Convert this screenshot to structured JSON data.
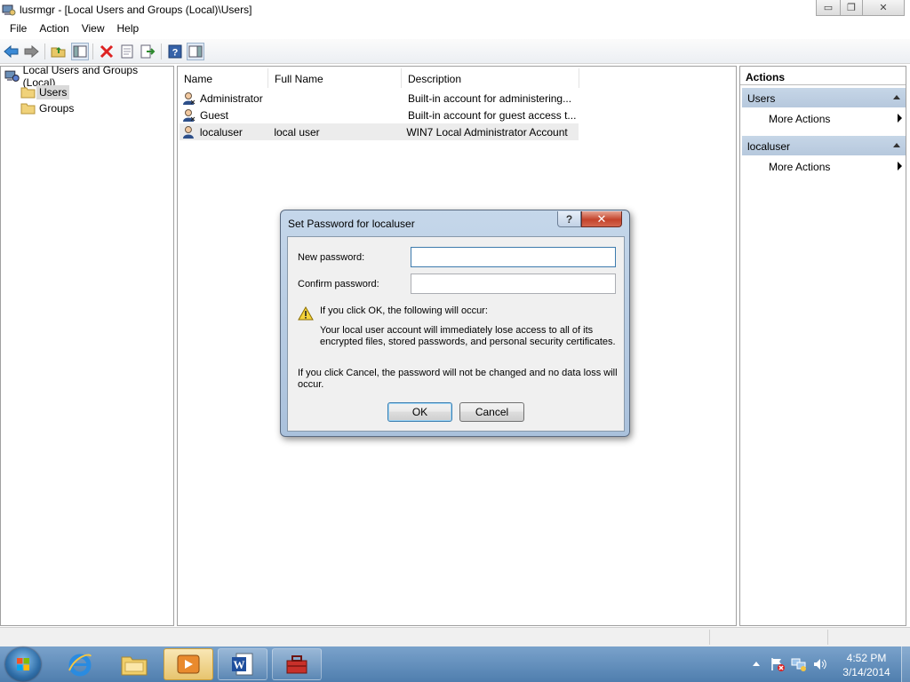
{
  "window": {
    "title": "lusrmgr - [Local Users and Groups (Local)\\Users]",
    "controls": {
      "minimize": "▭",
      "maximize": "❐",
      "close": "✕"
    }
  },
  "menu": [
    "File",
    "Action",
    "View",
    "Help"
  ],
  "toolbar": [
    "back-arrow-icon",
    "forward-arrow-icon",
    "up-folder-icon",
    "show-hide-tree-icon",
    "delete-icon",
    "properties-icon",
    "export-list-icon",
    "help-icon",
    "show-hide-action-pane-icon"
  ],
  "tree": {
    "root": "Local Users and Groups (Local)",
    "items": [
      "Users",
      "Groups"
    ],
    "selected": "Users"
  },
  "list": {
    "columns": [
      "Name",
      "Full Name",
      "Description"
    ],
    "rows": [
      {
        "name": "Administrator",
        "full_name": "",
        "description": "Built-in account for administering..."
      },
      {
        "name": "Guest",
        "full_name": "",
        "description": "Built-in account for guest access t..."
      },
      {
        "name": "localuser",
        "full_name": "local user",
        "description": "WIN7 Local Administrator Account"
      }
    ]
  },
  "actions": {
    "header": "Actions",
    "groups": [
      {
        "title": "Users",
        "item": "More Actions"
      },
      {
        "title": "localuser",
        "item": "More Actions"
      }
    ]
  },
  "dialog": {
    "title": "Set Password for localuser",
    "help": "?",
    "close": "✕",
    "new_password_label": "New password:",
    "new_password_value": "",
    "confirm_password_label": "Confirm password:",
    "confirm_password_value": "",
    "warning_title": "If you click OK, the following will occur:",
    "warning_line1": "Your local user account will immediately lose access to all of its",
    "warning_line2": "encrypted files, stored passwords, and personal security certificates.",
    "cancel_line1": "If you click Cancel, the password will not be changed and no data loss will",
    "cancel_line2": "occur.",
    "ok": "OK",
    "cancel": "Cancel"
  },
  "taskbar": {
    "apps": [
      "internet-explorer-icon",
      "windows-explorer-icon",
      "media-player-icon",
      "word-icon",
      "toolbox-icon"
    ],
    "active": "media-player-icon",
    "tray_icons": [
      "show-hidden-icons",
      "action-center-icon",
      "network-icon",
      "volume-icon"
    ],
    "time": "4:52 PM",
    "date": "3/14/2014"
  },
  "colors": {
    "accent": "#3c7fb1",
    "taskbar": "#5f8cba",
    "close_red": "#c4432b",
    "action_group": "#bccde1"
  }
}
